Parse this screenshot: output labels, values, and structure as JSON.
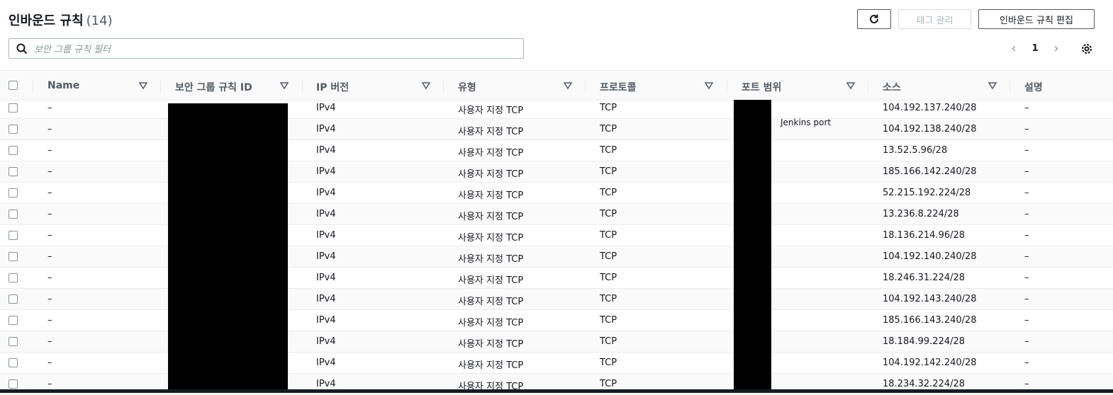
{
  "header": {
    "title": "인바운드 규칙",
    "count": "(14)"
  },
  "toolbar": {
    "tag_label": "태그 관리",
    "edit_label": "인바운드 규칙 편집"
  },
  "search": {
    "placeholder": "보안 그룹 규칙 필터"
  },
  "pagination": {
    "page": "1"
  },
  "columns": [
    "Name",
    "보안 그룹 규칙 ID",
    "IP 버전",
    "유형",
    "프로토콜",
    "포트 범위",
    "소스",
    "설명"
  ],
  "port_note": "Jenkins port",
  "rows": [
    {
      "name": "–",
      "ip": "IPv4",
      "type": "사용자 지정 TCP",
      "protocol": "TCP",
      "source": "104.192.137.240/28",
      "desc": "–"
    },
    {
      "name": "–",
      "ip": "IPv4",
      "type": "사용자 지정 TCP",
      "protocol": "TCP",
      "source": "104.192.138.240/28",
      "desc": "–"
    },
    {
      "name": "–",
      "ip": "IPv4",
      "type": "사용자 지정 TCP",
      "protocol": "TCP",
      "source": "13.52.5.96/28",
      "desc": "–"
    },
    {
      "name": "–",
      "ip": "IPv4",
      "type": "사용자 지정 TCP",
      "protocol": "TCP",
      "source": "185.166.142.240/28",
      "desc": "–"
    },
    {
      "name": "–",
      "ip": "IPv4",
      "type": "사용자 지정 TCP",
      "protocol": "TCP",
      "source": "52.215.192.224/28",
      "desc": "–"
    },
    {
      "name": "–",
      "ip": "IPv4",
      "type": "사용자 지정 TCP",
      "protocol": "TCP",
      "source": "13.236.8.224/28",
      "desc": "–"
    },
    {
      "name": "–",
      "ip": "IPv4",
      "type": "사용자 지정 TCP",
      "protocol": "TCP",
      "source": "18.136.214.96/28",
      "desc": "–"
    },
    {
      "name": "–",
      "ip": "IPv4",
      "type": "사용자 지정 TCP",
      "protocol": "TCP",
      "source": "104.192.140.240/28",
      "desc": "–"
    },
    {
      "name": "–",
      "ip": "IPv4",
      "type": "사용자 지정 TCP",
      "protocol": "TCP",
      "source": "18.246.31.224/28",
      "desc": "–"
    },
    {
      "name": "–",
      "ip": "IPv4",
      "type": "사용자 지정 TCP",
      "protocol": "TCP",
      "source": "104.192.143.240/28",
      "desc": "–"
    },
    {
      "name": "–",
      "ip": "IPv4",
      "type": "사용자 지정 TCP",
      "protocol": "TCP",
      "source": "185.166.143.240/28",
      "desc": "–"
    },
    {
      "name": "–",
      "ip": "IPv4",
      "type": "사용자 지정 TCP",
      "protocol": "TCP",
      "source": "18.184.99.224/28",
      "desc": "–"
    },
    {
      "name": "–",
      "ip": "IPv4",
      "type": "사용자 지정 TCP",
      "protocol": "TCP",
      "source": "104.192.142.240/28",
      "desc": "–"
    },
    {
      "name": "–",
      "ip": "IPv4",
      "type": "사용자 지정 TCP",
      "protocol": "TCP",
      "source": "18.234.32.224/28",
      "desc": "–"
    }
  ]
}
